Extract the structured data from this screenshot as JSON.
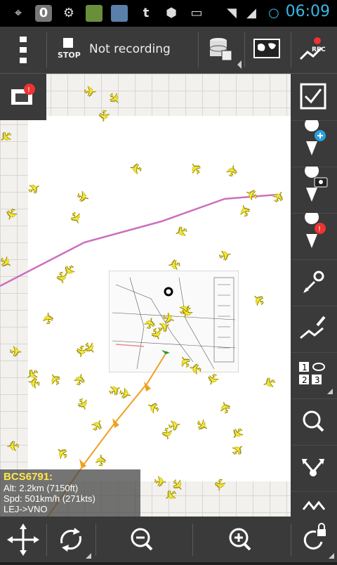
{
  "status_bar": {
    "time": "06:09",
    "icons": [
      "gps-icon",
      "notification-app-icon",
      "settings-icon",
      "game-icon",
      "photo-icon",
      "tumblr-icon",
      "chat-icon",
      "no-sim-icon",
      "wifi-icon",
      "signal-icon",
      "circle-icon"
    ]
  },
  "toolbar": {
    "stop_label": "STOP",
    "recording_status": "Not recording",
    "rec_label": "REC",
    "icons": [
      "menu-icon",
      "stop-icon",
      "database-icon",
      "world-map-icon",
      "record-track-icon"
    ]
  },
  "map": {
    "route_color": "#cc6fbf",
    "track_color": "#f0a020",
    "plane_color": "#f2e833"
  },
  "info": {
    "callsign": "BCS6791:",
    "altitude": "Alt: 2.2km (7150ft)",
    "speed": "Spd: 501km/h (271kts)",
    "route": "LEJ->VNO"
  },
  "sidebar": {
    "icons": [
      "alert-layer-icon",
      "checkbox-icon",
      "add-waypoint-icon",
      "photo-waypoint-icon",
      "alert-waypoint-icon",
      "measure-icon",
      "draw-track-icon",
      "grid-view-icon",
      "search-icon",
      "share-icon",
      "layers-icon"
    ]
  },
  "bottombar": {
    "icons": [
      "move-icon",
      "rotate-icon",
      "zoom-out-icon",
      "zoom-in-icon",
      "lock-rotation-icon"
    ]
  }
}
